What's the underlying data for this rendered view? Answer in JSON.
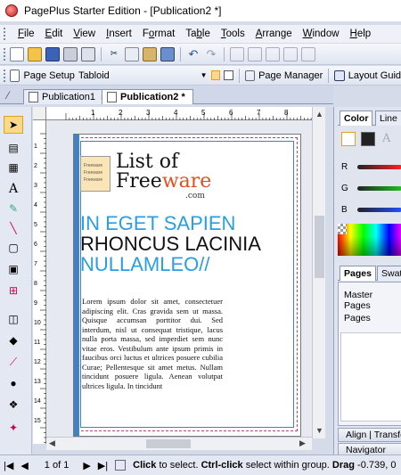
{
  "window": {
    "title": "PagePlus Starter Edition  - [Publication2 *]"
  },
  "menu": {
    "items": [
      {
        "label": "File",
        "u": "F",
        "rest": "ile"
      },
      {
        "label": "Edit",
        "u": "E",
        "rest": "dit"
      },
      {
        "label": "View",
        "u": "V",
        "rest": "iew"
      },
      {
        "label": "Insert",
        "u": "I",
        "rest": "nsert"
      },
      {
        "label": "Format",
        "pre": "F",
        "u": "o",
        "rest": "rmat"
      },
      {
        "label": "Table",
        "pre": "Ta",
        "u": "b",
        "rest": "le"
      },
      {
        "label": "Tools",
        "u": "T",
        "rest": "ools"
      },
      {
        "label": "Arrange",
        "u": "A",
        "rest": "rrange"
      },
      {
        "label": "Window",
        "u": "W",
        "rest": "indow"
      },
      {
        "label": "Help",
        "u": "H",
        "rest": "elp"
      }
    ]
  },
  "toolbar2": {
    "page_setup": "Page Setup",
    "page_size": "Tabloid",
    "page_manager": "Page Manager",
    "layout_guides": "Layout Guid"
  },
  "tabs": [
    {
      "label": "Publication1",
      "active": false
    },
    {
      "label": "Publication2 *",
      "active": true
    }
  ],
  "ruler": {
    "numbers": [
      "1",
      "2",
      "3",
      "4",
      "5",
      "6",
      "7",
      "8",
      "9"
    ],
    "left_numbers": [
      "1",
      "2",
      "3",
      "4",
      "5",
      "6",
      "7",
      "8",
      "9",
      "10",
      "11",
      "12",
      "13",
      "14",
      "15",
      "16"
    ]
  },
  "logo": {
    "line1": "List of",
    "line2_a": "Free",
    "line2_b": "ware",
    "sub": ".com",
    "clip_items": [
      "Freeware",
      "Freeware",
      "Freeware"
    ]
  },
  "heading": {
    "line1": "IN EGET SAPIEN",
    "line2": "RHONCUS LACINIA",
    "line3": "NULLAMLEO//"
  },
  "body_text": "Lorem ipsum dolor sit amet, consectetuer adipiscing elit. Cras gravida sem ut massa. Quisque accumsan porttitor dui. Sed interdum, nisl ut consequat tristique, lacus nulla porta massa, sed imperdiet sem nunc vitae eros. Vestibulum ante ipsum primis in faucibus orci luctus et ultrices posuere cubilia Curae; Pellentesque sit amet metus. Nullam tincidunt posuere ligula. Aenean volutpat ultrices ligula. In tincidunt",
  "right_panel": {
    "tab_color": "Color",
    "tab_line": "Line",
    "r": "R",
    "g": "G",
    "b": "B",
    "pages_tab": "Pages",
    "swatches_tab": "Swat",
    "master_pages": "Master Pages",
    "pages": "Pages",
    "align": "Align | Transfor",
    "navigator": "Navigator"
  },
  "status": {
    "page_indicator": "1 of 1",
    "click": "Click",
    "to_select": " to select. ",
    "ctrl_click": "Ctrl-click",
    "within_group": " select within group. ",
    "drag": "Drag",
    "coords": " -0.739, 0"
  },
  "colors": {
    "accent_blue": "#2b9ee0",
    "freeware_orange": "#e0501e",
    "selection": "#fbd98b"
  }
}
